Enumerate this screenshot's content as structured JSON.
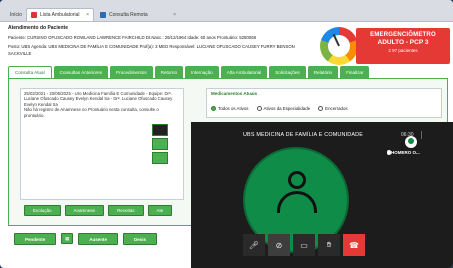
{
  "tabs": [
    {
      "label": "Início"
    },
    {
      "label": "Lista Ambulatorial",
      "close": "×"
    },
    {
      "label": "Consulta Remota",
      "close": "×"
    }
  ],
  "patient": {
    "section_title": "Atendimento do Paciente",
    "line1": "Paciente: CURSINO OFUSCADO ROWLAND LAWRENCE FAIRCHILD   Dt.Nasc.: 29/12/1964   Idade: 60 anos   Prontuário: 5250068",
    "line2": "Posto: UBS   Agenda: UBS MEDICINA DE FAMÍLIA E COMUNIDADE   Prof(a): 3 MED   Responsável: LUCIANE OFUSCADO CAUSEY FURRY BENSON",
    "line3": "SACKVILLE"
  },
  "emergencimetro": {
    "title": "EMERGENCIÔMETRO",
    "level": "ADULTO - PCP 3",
    "count": "2 97 pacientes",
    "color": "#e53935"
  },
  "navtabs": [
    {
      "label": "Consulta Atual",
      "active": true
    },
    {
      "label": "Consultas Anteriores"
    },
    {
      "label": "Procedimentos"
    },
    {
      "label": "Retorno"
    },
    {
      "label": "Internação"
    },
    {
      "label": "Alta Ambulatorial"
    },
    {
      "label": "Solicitações"
    },
    {
      "label": "Relatório"
    },
    {
      "label": "Finalizar"
    }
  ],
  "notes": {
    "text": "25/02/2021 - 20/05/2025 - Uro Medicina Família E Comunidade - Equipe: Drª. Luciane Ofuscado Causey Evelyn Kendal Sa - Drª. Luciane Ofuscado Causey Evelyn Kendal Sa\nNão há registro de Anamnese no Prontuário nesta consulta, consulte o prontuário."
  },
  "medications": {
    "title": "Medicamentos Atuais",
    "options": [
      {
        "label": "Todos os Ativos",
        "selected": true
      },
      {
        "label": "Ativos da Especialidade",
        "selected": false
      },
      {
        "label": "Encerrados",
        "selected": false
      }
    ]
  },
  "buttons_row1": [
    "Evolução",
    "Anamnese",
    "Receitas",
    "Ate"
  ],
  "buttons_row2": {
    "pendente": "Pendente",
    "icon_btn": "▦",
    "ausente": "Ausente",
    "last": "Desis"
  },
  "video": {
    "title": "UBS MEDICINA DE FAMÍLIA E COMUNIDADE",
    "time": "06:30",
    "participant_name": "HOMERO O...",
    "avatar_color": "#0f8c47",
    "controls": [
      {
        "icon": "microphone-icon",
        "glyph": "🎤︎"
      },
      {
        "icon": "camera-off-icon",
        "glyph": "⊘"
      },
      {
        "icon": "screen-share-icon",
        "glyph": "▭"
      },
      {
        "icon": "raise-hand-icon",
        "glyph": "✋︎"
      },
      {
        "icon": "hang-up-icon",
        "glyph": "☎"
      }
    ]
  }
}
